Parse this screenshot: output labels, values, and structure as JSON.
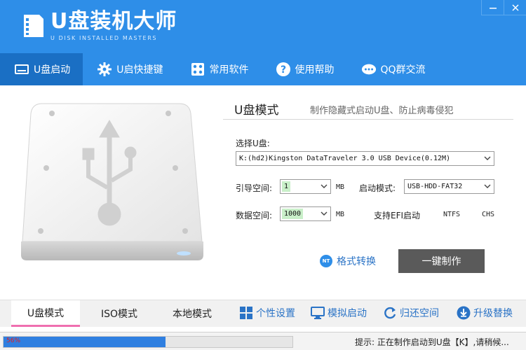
{
  "app": {
    "title": "U盘装机大师",
    "subtitle": "U DISK INSTALLED MASTERS"
  },
  "window": {
    "minimize_icon": "minimize-icon",
    "close_icon": "close-icon"
  },
  "nav": {
    "items": [
      {
        "label": "U盘启动",
        "icon": "usb-drive-icon",
        "active": true
      },
      {
        "label": "U启快捷键",
        "icon": "gear-icon",
        "active": false
      },
      {
        "label": "常用软件",
        "icon": "apps-icon",
        "active": false
      },
      {
        "label": "使用帮助",
        "icon": "help-icon",
        "active": false
      },
      {
        "label": "QQ群交流",
        "icon": "chat-icon",
        "active": false
      }
    ]
  },
  "main": {
    "mode_title": "U盘模式",
    "mode_desc": "制作隐藏式启动U盘、防止病毒侵犯",
    "select_disk_label": "选择U盘:",
    "selected_disk": "K:(hd2)Kingston DataTraveler 3.0 USB Device(0.12M)",
    "boot_space_label": "引导空间:",
    "boot_space_value": "1",
    "boot_space_unit": "MB",
    "boot_mode_label": "启动模式:",
    "boot_mode_value": "USB-HDD-FAT32",
    "data_space_label": "数据空间:",
    "data_space_value": "1000",
    "data_space_unit": "MB",
    "efi_label": "支持EFI启动",
    "ntfs_label": "NTFS",
    "chs_label": "CHS",
    "format_link_badge": "NT",
    "format_link": "格式转换",
    "make_button": "一键制作"
  },
  "bottom": {
    "tabs": [
      {
        "label": "U盘模式",
        "active": true
      },
      {
        "label": "ISO模式",
        "active": false
      },
      {
        "label": "本地模式",
        "active": false
      }
    ],
    "tools": [
      {
        "label": "个性设置",
        "icon": "windows-grid-icon"
      },
      {
        "label": "模拟启动",
        "icon": "monitor-icon"
      },
      {
        "label": "归还空间",
        "icon": "refresh-icon"
      },
      {
        "label": "升级替换",
        "icon": "download-icon"
      }
    ]
  },
  "status": {
    "progress_text": "56%",
    "progress": 0.56,
    "message": "提示: 正在制作启动到U盘【K】,请稍候..."
  },
  "colors": {
    "header_blue": "#2e8ee8",
    "nav_active": "#1a6fc4",
    "link_blue": "#2a73c6",
    "tab_underline": "#ef6fb0",
    "progress_fill": "#2f7fe0",
    "button_gray": "#5a5a5a"
  }
}
